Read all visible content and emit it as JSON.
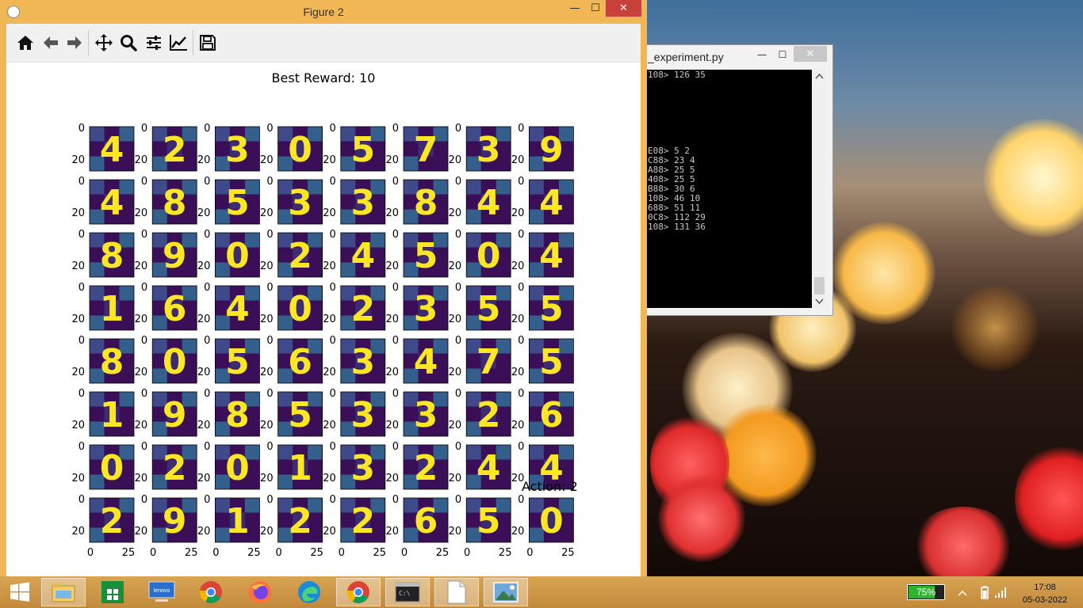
{
  "figure_window": {
    "title": "Figure 2",
    "minimize": "—",
    "maximize": "☐",
    "close": "✕",
    "toolbar": [
      "home-icon",
      "back-icon",
      "forward-icon",
      "pan-icon",
      "zoom-icon",
      "subplots-icon",
      "customize-icon",
      "save-icon"
    ],
    "best_reward_label": "Best Reward: 10",
    "action_label": "Action: 2",
    "grid": {
      "rows": 8,
      "cols": 8,
      "digits": [
        [
          "4",
          "2",
          "3",
          "0",
          "5",
          "7",
          "3",
          "9"
        ],
        [
          "4",
          "8",
          "5",
          "3",
          "3",
          "8",
          "4",
          "4"
        ],
        [
          "8",
          "9",
          "0",
          "2",
          "4",
          "5",
          "0",
          "4"
        ],
        [
          "1",
          "6",
          "4",
          "0",
          "2",
          "3",
          "5",
          "5"
        ],
        [
          "8",
          "0",
          "5",
          "6",
          "3",
          "4",
          "7",
          "5"
        ],
        [
          "1",
          "9",
          "8",
          "5",
          "3",
          "3",
          "2",
          "6"
        ],
        [
          "0",
          "2",
          "0",
          "1",
          "3",
          "2",
          "4",
          "4"
        ],
        [
          "2",
          "9",
          "1",
          "2",
          "2",
          "6",
          "5",
          "0"
        ]
      ],
      "y_tick_labels": [
        "0",
        "20"
      ],
      "x_tick_labels": [
        "0",
        "25"
      ],
      "colors": {
        "tile_dark": "#3b0f58",
        "tile_mid": "#3f4a8a",
        "tile_light": "#345f8c",
        "digit": "#fde725"
      }
    }
  },
  "console_window": {
    "title": "_experiment.py",
    "minimize": "—",
    "maximize": "☐",
    "close": "✕",
    "lines": [
      "108> 126 35",
      "",
      "",
      "",
      "",
      "",
      "",
      "",
      "E08> 5 2",
      "C88> 23 4",
      "A88> 25 5",
      "408> 25 5",
      "B88> 30 6",
      "108> 46 10",
      "688> 51 11",
      "0C8> 112 29",
      "108> 131 36"
    ]
  },
  "taskbar": {
    "items": [
      "windows-start",
      "file-explorer",
      "store",
      "lenovo-app",
      "chrome",
      "firefox",
      "edge",
      "chrome-2",
      "cmd",
      "notepad",
      "photos"
    ],
    "battery_percent": "75%",
    "battery_level": 0.75,
    "time": "17:08",
    "date": "05-03-2022"
  }
}
